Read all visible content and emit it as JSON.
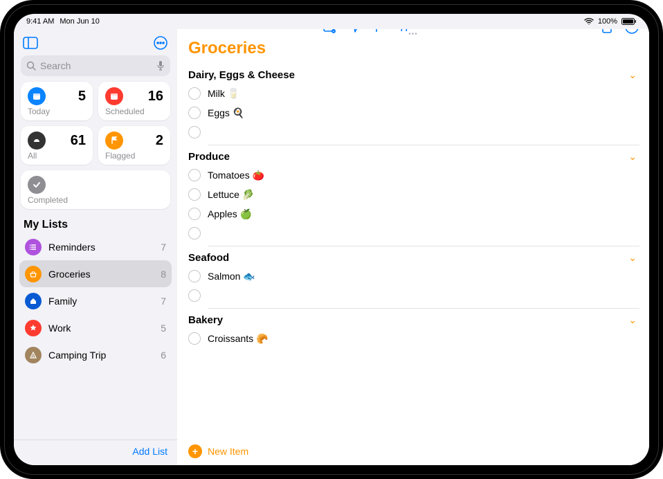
{
  "status": {
    "time": "9:41 AM",
    "date": "Mon Jun 10",
    "battery": "100%"
  },
  "sidebar": {
    "search_placeholder": "Search",
    "cards": {
      "today": {
        "label": "Today",
        "count": "5"
      },
      "scheduled": {
        "label": "Scheduled",
        "count": "16"
      },
      "all": {
        "label": "All",
        "count": "61"
      },
      "flagged": {
        "label": "Flagged",
        "count": "2"
      },
      "completed": {
        "label": "Completed"
      }
    },
    "lists_header": "My Lists",
    "lists": [
      {
        "name": "Reminders",
        "count": "7"
      },
      {
        "name": "Groceries",
        "count": "8"
      },
      {
        "name": "Family",
        "count": "7"
      },
      {
        "name": "Work",
        "count": "5"
      },
      {
        "name": "Camping Trip",
        "count": "6"
      }
    ],
    "add_list_label": "Add List"
  },
  "content": {
    "title": "Groceries",
    "new_item_label": "New Item",
    "sections": [
      {
        "name": "Dairy, Eggs & Cheese",
        "items": [
          "Milk 🥛",
          "Eggs 🍳"
        ]
      },
      {
        "name": "Produce",
        "items": [
          "Tomatoes 🍅",
          "Lettuce 🥬",
          "Apples 🍏"
        ]
      },
      {
        "name": "Seafood",
        "items": [
          "Salmon 🐟"
        ]
      },
      {
        "name": "Bakery",
        "items": [
          "Croissants 🥐"
        ]
      }
    ]
  }
}
